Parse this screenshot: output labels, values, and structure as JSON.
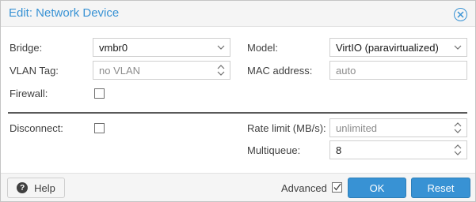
{
  "window": {
    "title": "Edit: Network Device"
  },
  "form": {
    "bridge": {
      "label": "Bridge:",
      "value": "vmbr0"
    },
    "vlan_tag": {
      "label": "VLAN Tag:",
      "placeholder": "no VLAN"
    },
    "firewall": {
      "label": "Firewall:",
      "checked": false
    },
    "model": {
      "label": "Model:",
      "value": "VirtIO (paravirtualized)"
    },
    "mac_address": {
      "label": "MAC address:",
      "placeholder": "auto"
    },
    "disconnect": {
      "label": "Disconnect:",
      "checked": false
    },
    "rate_limit": {
      "label": "Rate limit (MB/s):",
      "placeholder": "unlimited"
    },
    "multiqueue": {
      "label": "Multiqueue:",
      "value": "8"
    }
  },
  "footer": {
    "help_label": "Help",
    "advanced_label": "Advanced",
    "advanced_checked": true,
    "ok_label": "OK",
    "reset_label": "Reset"
  },
  "colors": {
    "accent": "#3892d4",
    "title_text": "#3892d4",
    "divider": "#5a5a5a"
  },
  "icons": {
    "close": "close-circle-icon",
    "dropdown": "chevron-down-icon",
    "spinner": "spinner-arrows-icon",
    "help": "question-circle-icon",
    "checkmark": "checkmark-icon"
  }
}
